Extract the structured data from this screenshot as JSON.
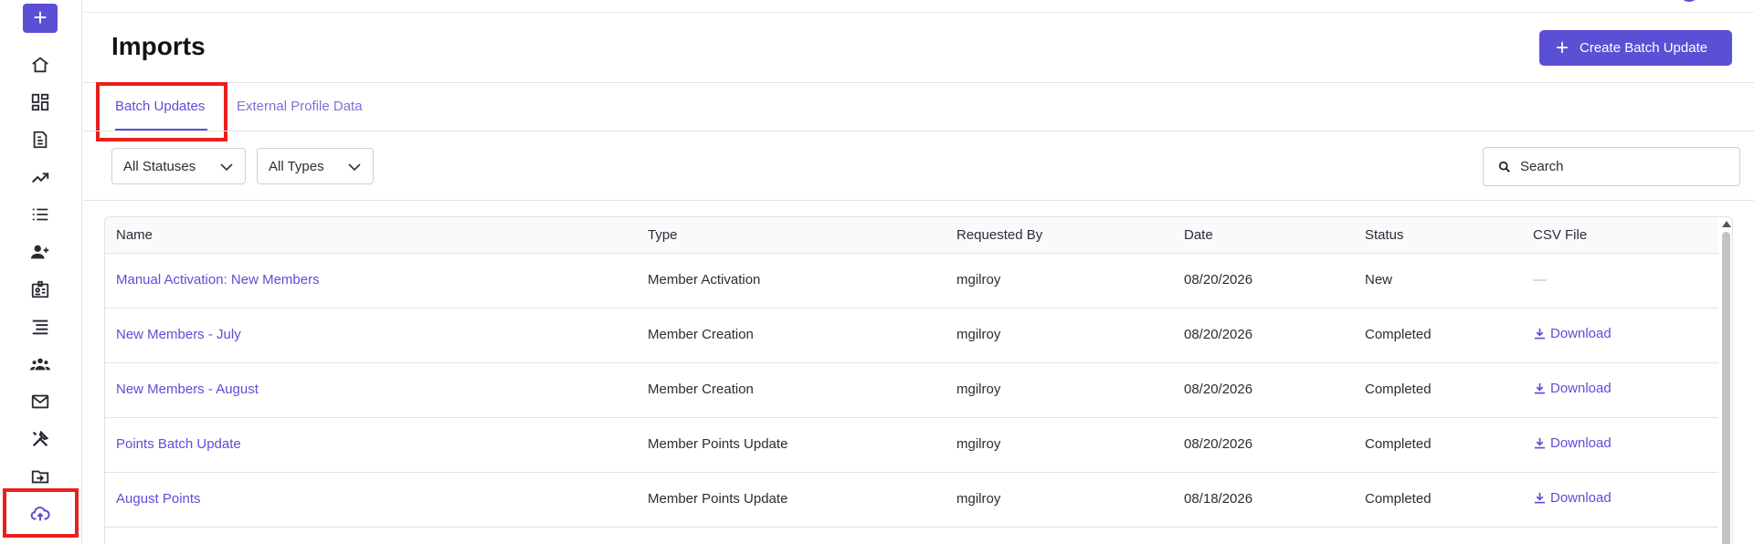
{
  "header": {
    "title": "Imports",
    "create_button": "Create Batch Update"
  },
  "sidebar": {
    "add_label": "+",
    "items": [
      {
        "icon": "home-icon"
      },
      {
        "icon": "dashboard-icon"
      },
      {
        "icon": "document-icon"
      },
      {
        "icon": "trending-icon"
      },
      {
        "icon": "list-icon"
      },
      {
        "icon": "add-user-icon"
      },
      {
        "icon": "badge-icon"
      },
      {
        "icon": "lines-icon"
      },
      {
        "icon": "group-icon"
      },
      {
        "icon": "mail-icon"
      },
      {
        "icon": "tools-icon"
      },
      {
        "icon": "folder-import-icon"
      },
      {
        "icon": "cloud-upload-icon",
        "active": true
      }
    ]
  },
  "tabs": [
    {
      "label": "Batch Updates",
      "active": true
    },
    {
      "label": "External Profile Data",
      "active": false
    }
  ],
  "filters": {
    "status": "All Statuses",
    "type": "All Types",
    "search_placeholder": "Search"
  },
  "table": {
    "columns": [
      "Name",
      "Type",
      "Requested By",
      "Date",
      "Status",
      "CSV File"
    ],
    "rows": [
      {
        "name": "Manual Activation: New Members",
        "type": "Member Activation",
        "requested_by": "mgilroy",
        "date": "08/20/2026",
        "status": "New",
        "csv": "—"
      },
      {
        "name": "New Members - July",
        "type": "Member Creation",
        "requested_by": "mgilroy",
        "date": "08/20/2026",
        "status": "Completed",
        "csv": "Download"
      },
      {
        "name": "New Members - August",
        "type": "Member Creation",
        "requested_by": "mgilroy",
        "date": "08/20/2026",
        "status": "Completed",
        "csv": "Download"
      },
      {
        "name": "Points Batch Update",
        "type": "Member Points Update",
        "requested_by": "mgilroy",
        "date": "08/20/2026",
        "status": "Completed",
        "csv": "Download"
      },
      {
        "name": "August Points",
        "type": "Member Points Update",
        "requested_by": "mgilroy",
        "date": "08/18/2026",
        "status": "Completed",
        "csv": "Download"
      }
    ]
  },
  "colors": {
    "accent": "#5b4fd6",
    "highlight": "#e8201e"
  }
}
